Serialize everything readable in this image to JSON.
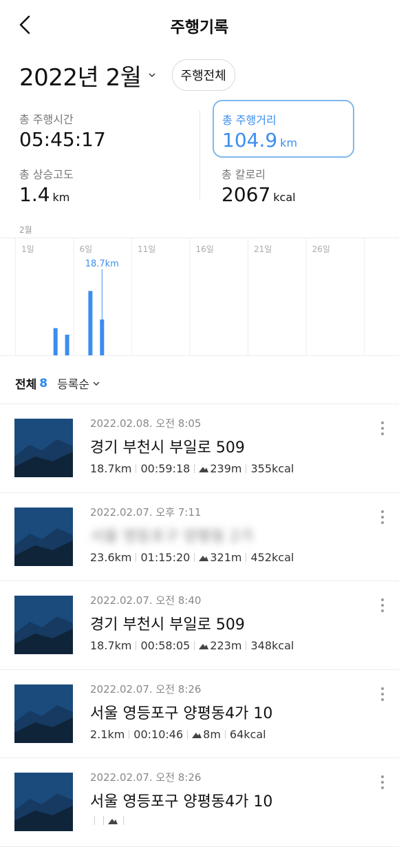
{
  "header": {
    "title": "주행기록"
  },
  "month_selector": {
    "month": "2022년 2월",
    "filter": "주행전체"
  },
  "stats": {
    "time": {
      "label": "총 주행시간",
      "value": "05:45:17",
      "unit": ""
    },
    "distance": {
      "label": "총 주행거리",
      "value": "104.9",
      "unit": "km"
    },
    "elevation": {
      "label": "총 상승고도",
      "value": "1.4",
      "unit": "km"
    },
    "calories": {
      "label": "총 칼로리",
      "value": "2067",
      "unit": "kcal"
    }
  },
  "colors": {
    "accent": "#2a86f0",
    "bar": "#3b8ef0",
    "thumb_dark": "#0f2438",
    "thumb_light": "#1b4b7d"
  },
  "chart_data": {
    "type": "bar",
    "title": "2월",
    "xlabel": "",
    "ylabel": "",
    "x_ticks": [
      "1일",
      "6일",
      "11일",
      "16일",
      "21일",
      "26일"
    ],
    "days": [
      4,
      5,
      7,
      8
    ],
    "values": [
      7.9,
      6.0,
      18.7,
      10.4
    ],
    "ylim": [
      0,
      25
    ],
    "highlighted_day": 8,
    "highlight_label": "18.7km"
  },
  "list": {
    "all_label": "전체",
    "count": "8",
    "sort_label": "등록순"
  },
  "records": [
    {
      "date": "2022.02.08. 오전 8:05",
      "address": "경기 부천시 부일로 509",
      "distance": "18.7km",
      "duration": "00:59:18",
      "elevation": "239m",
      "calories": "355kcal",
      "blurred": false
    },
    {
      "date": "2022.02.07. 오후 7:11",
      "address": "서울 영등포구 양평동 2가",
      "distance": "23.6km",
      "duration": "01:15:20",
      "elevation": "321m",
      "calories": "452kcal",
      "blurred": true
    },
    {
      "date": "2022.02.07. 오전 8:40",
      "address": "경기 부천시 부일로 509",
      "distance": "18.7km",
      "duration": "00:58:05",
      "elevation": "223m",
      "calories": "348kcal",
      "blurred": false
    },
    {
      "date": "2022.02.07. 오전 8:26",
      "address": "서울 영등포구 양평동4가 10",
      "distance": "2.1km",
      "duration": "00:10:46",
      "elevation": "8m",
      "calories": "64kcal",
      "blurred": false
    },
    {
      "date": "2022.02.07. 오전 8:26",
      "address": "서울 영등포구 양평동4가 10",
      "distance": "",
      "duration": "",
      "elevation": "",
      "calories": "",
      "blurred": false
    }
  ]
}
